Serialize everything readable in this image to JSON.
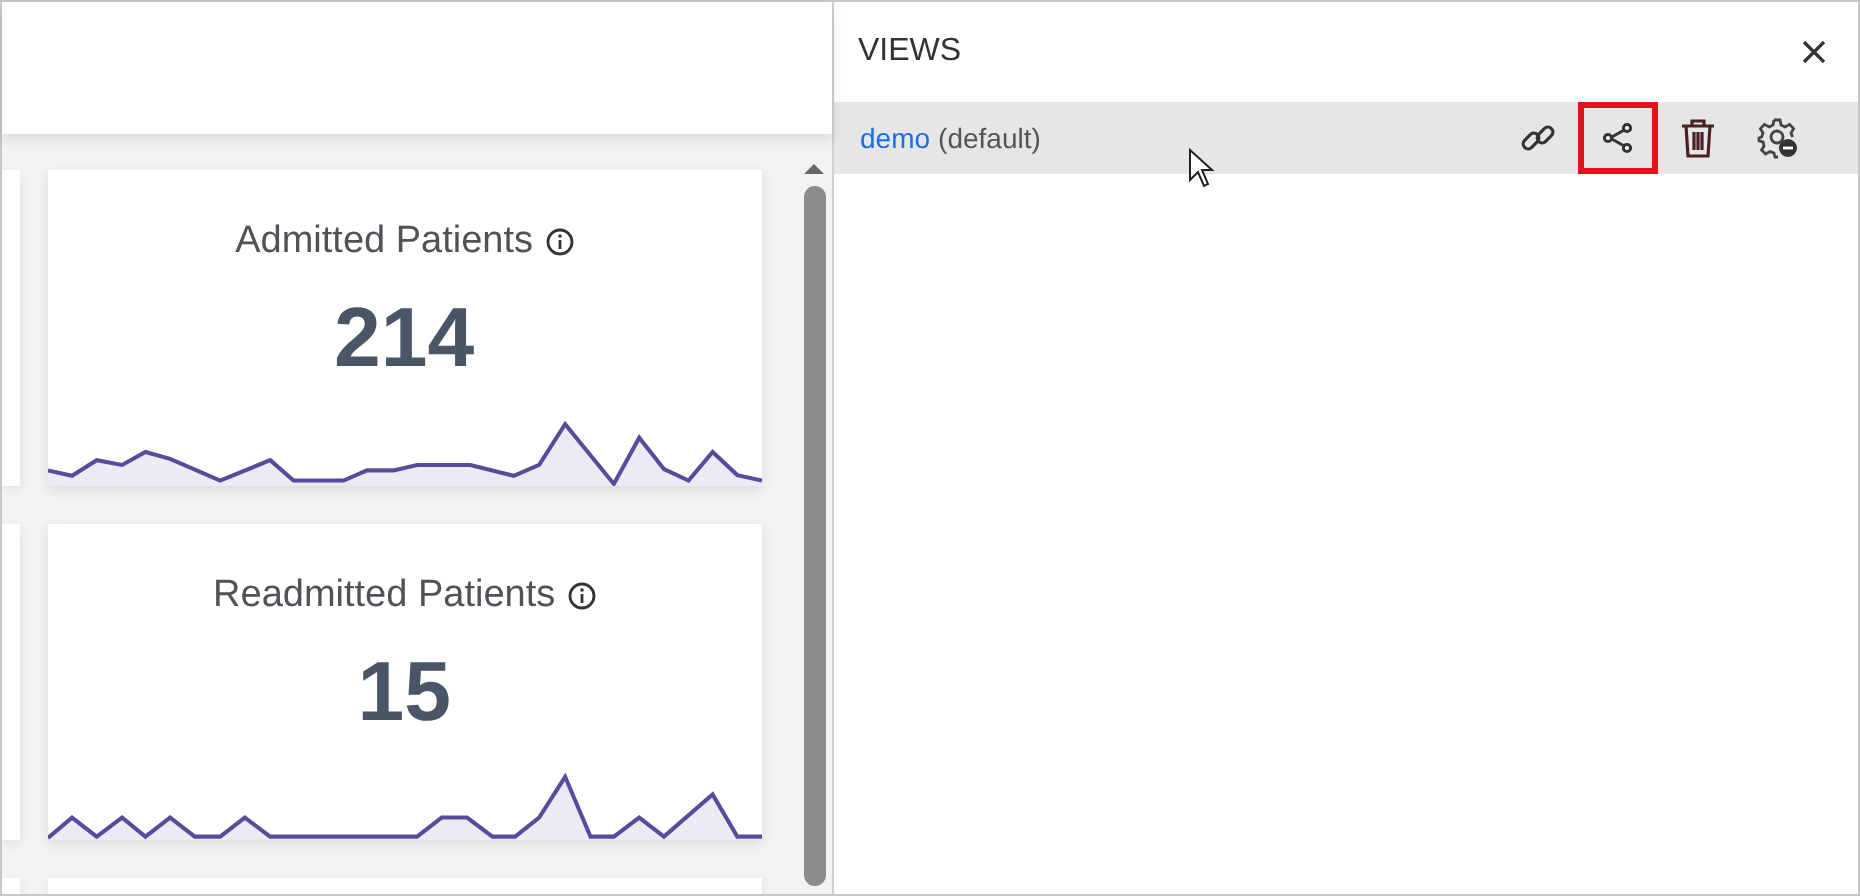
{
  "dashboard": {
    "cards": [
      {
        "title": "Admitted Patients",
        "value": "214"
      },
      {
        "title": "Readmitted Patients",
        "value": "15"
      }
    ]
  },
  "views_panel": {
    "title": "VIEWS",
    "views": [
      {
        "name": "demo",
        "suffix": "(default)",
        "selected": true,
        "actions": [
          {
            "kind": "link",
            "highlighted": false
          },
          {
            "kind": "share",
            "highlighted": true
          },
          {
            "kind": "delete",
            "highlighted": false
          },
          {
            "kind": "settings",
            "highlighted": false
          }
        ]
      }
    ]
  }
}
